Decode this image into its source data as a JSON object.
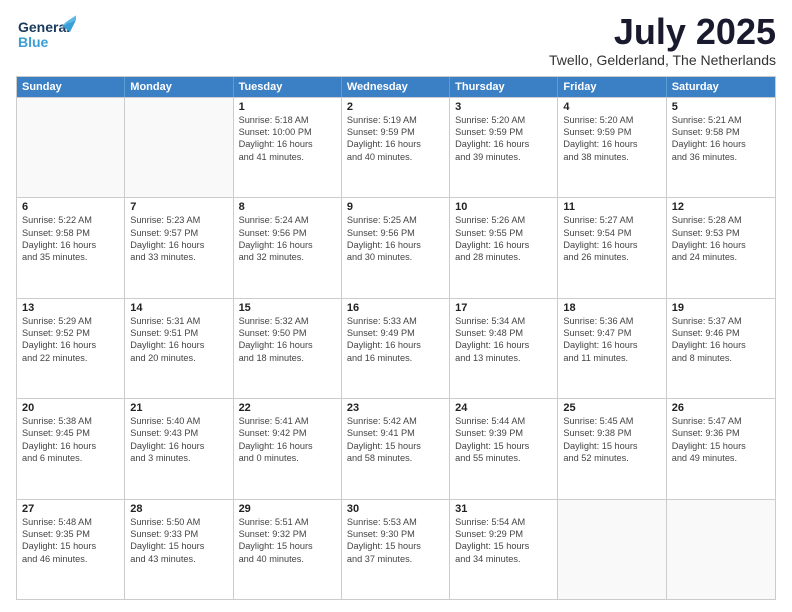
{
  "header": {
    "logo_line1": "General",
    "logo_line2": "Blue",
    "month": "July 2025",
    "location": "Twello, Gelderland, The Netherlands"
  },
  "weekdays": [
    "Sunday",
    "Monday",
    "Tuesday",
    "Wednesday",
    "Thursday",
    "Friday",
    "Saturday"
  ],
  "rows": [
    [
      {
        "day": "",
        "lines": [],
        "empty": true
      },
      {
        "day": "",
        "lines": [],
        "empty": true
      },
      {
        "day": "1",
        "lines": [
          "Sunrise: 5:18 AM",
          "Sunset: 10:00 PM",
          "Daylight: 16 hours",
          "and 41 minutes."
        ]
      },
      {
        "day": "2",
        "lines": [
          "Sunrise: 5:19 AM",
          "Sunset: 9:59 PM",
          "Daylight: 16 hours",
          "and 40 minutes."
        ]
      },
      {
        "day": "3",
        "lines": [
          "Sunrise: 5:20 AM",
          "Sunset: 9:59 PM",
          "Daylight: 16 hours",
          "and 39 minutes."
        ]
      },
      {
        "day": "4",
        "lines": [
          "Sunrise: 5:20 AM",
          "Sunset: 9:59 PM",
          "Daylight: 16 hours",
          "and 38 minutes."
        ]
      },
      {
        "day": "5",
        "lines": [
          "Sunrise: 5:21 AM",
          "Sunset: 9:58 PM",
          "Daylight: 16 hours",
          "and 36 minutes."
        ]
      }
    ],
    [
      {
        "day": "6",
        "lines": [
          "Sunrise: 5:22 AM",
          "Sunset: 9:58 PM",
          "Daylight: 16 hours",
          "and 35 minutes."
        ]
      },
      {
        "day": "7",
        "lines": [
          "Sunrise: 5:23 AM",
          "Sunset: 9:57 PM",
          "Daylight: 16 hours",
          "and 33 minutes."
        ]
      },
      {
        "day": "8",
        "lines": [
          "Sunrise: 5:24 AM",
          "Sunset: 9:56 PM",
          "Daylight: 16 hours",
          "and 32 minutes."
        ]
      },
      {
        "day": "9",
        "lines": [
          "Sunrise: 5:25 AM",
          "Sunset: 9:56 PM",
          "Daylight: 16 hours",
          "and 30 minutes."
        ]
      },
      {
        "day": "10",
        "lines": [
          "Sunrise: 5:26 AM",
          "Sunset: 9:55 PM",
          "Daylight: 16 hours",
          "and 28 minutes."
        ]
      },
      {
        "day": "11",
        "lines": [
          "Sunrise: 5:27 AM",
          "Sunset: 9:54 PM",
          "Daylight: 16 hours",
          "and 26 minutes."
        ]
      },
      {
        "day": "12",
        "lines": [
          "Sunrise: 5:28 AM",
          "Sunset: 9:53 PM",
          "Daylight: 16 hours",
          "and 24 minutes."
        ]
      }
    ],
    [
      {
        "day": "13",
        "lines": [
          "Sunrise: 5:29 AM",
          "Sunset: 9:52 PM",
          "Daylight: 16 hours",
          "and 22 minutes."
        ]
      },
      {
        "day": "14",
        "lines": [
          "Sunrise: 5:31 AM",
          "Sunset: 9:51 PM",
          "Daylight: 16 hours",
          "and 20 minutes."
        ]
      },
      {
        "day": "15",
        "lines": [
          "Sunrise: 5:32 AM",
          "Sunset: 9:50 PM",
          "Daylight: 16 hours",
          "and 18 minutes."
        ]
      },
      {
        "day": "16",
        "lines": [
          "Sunrise: 5:33 AM",
          "Sunset: 9:49 PM",
          "Daylight: 16 hours",
          "and 16 minutes."
        ]
      },
      {
        "day": "17",
        "lines": [
          "Sunrise: 5:34 AM",
          "Sunset: 9:48 PM",
          "Daylight: 16 hours",
          "and 13 minutes."
        ]
      },
      {
        "day": "18",
        "lines": [
          "Sunrise: 5:36 AM",
          "Sunset: 9:47 PM",
          "Daylight: 16 hours",
          "and 11 minutes."
        ]
      },
      {
        "day": "19",
        "lines": [
          "Sunrise: 5:37 AM",
          "Sunset: 9:46 PM",
          "Daylight: 16 hours",
          "and 8 minutes."
        ]
      }
    ],
    [
      {
        "day": "20",
        "lines": [
          "Sunrise: 5:38 AM",
          "Sunset: 9:45 PM",
          "Daylight: 16 hours",
          "and 6 minutes."
        ]
      },
      {
        "day": "21",
        "lines": [
          "Sunrise: 5:40 AM",
          "Sunset: 9:43 PM",
          "Daylight: 16 hours",
          "and 3 minutes."
        ]
      },
      {
        "day": "22",
        "lines": [
          "Sunrise: 5:41 AM",
          "Sunset: 9:42 PM",
          "Daylight: 16 hours",
          "and 0 minutes."
        ]
      },
      {
        "day": "23",
        "lines": [
          "Sunrise: 5:42 AM",
          "Sunset: 9:41 PM",
          "Daylight: 15 hours",
          "and 58 minutes."
        ]
      },
      {
        "day": "24",
        "lines": [
          "Sunrise: 5:44 AM",
          "Sunset: 9:39 PM",
          "Daylight: 15 hours",
          "and 55 minutes."
        ]
      },
      {
        "day": "25",
        "lines": [
          "Sunrise: 5:45 AM",
          "Sunset: 9:38 PM",
          "Daylight: 15 hours",
          "and 52 minutes."
        ]
      },
      {
        "day": "26",
        "lines": [
          "Sunrise: 5:47 AM",
          "Sunset: 9:36 PM",
          "Daylight: 15 hours",
          "and 49 minutes."
        ]
      }
    ],
    [
      {
        "day": "27",
        "lines": [
          "Sunrise: 5:48 AM",
          "Sunset: 9:35 PM",
          "Daylight: 15 hours",
          "and 46 minutes."
        ]
      },
      {
        "day": "28",
        "lines": [
          "Sunrise: 5:50 AM",
          "Sunset: 9:33 PM",
          "Daylight: 15 hours",
          "and 43 minutes."
        ]
      },
      {
        "day": "29",
        "lines": [
          "Sunrise: 5:51 AM",
          "Sunset: 9:32 PM",
          "Daylight: 15 hours",
          "and 40 minutes."
        ]
      },
      {
        "day": "30",
        "lines": [
          "Sunrise: 5:53 AM",
          "Sunset: 9:30 PM",
          "Daylight: 15 hours",
          "and 37 minutes."
        ]
      },
      {
        "day": "31",
        "lines": [
          "Sunrise: 5:54 AM",
          "Sunset: 9:29 PM",
          "Daylight: 15 hours",
          "and 34 minutes."
        ]
      },
      {
        "day": "",
        "lines": [],
        "empty": true
      },
      {
        "day": "",
        "lines": [],
        "empty": true
      }
    ]
  ]
}
